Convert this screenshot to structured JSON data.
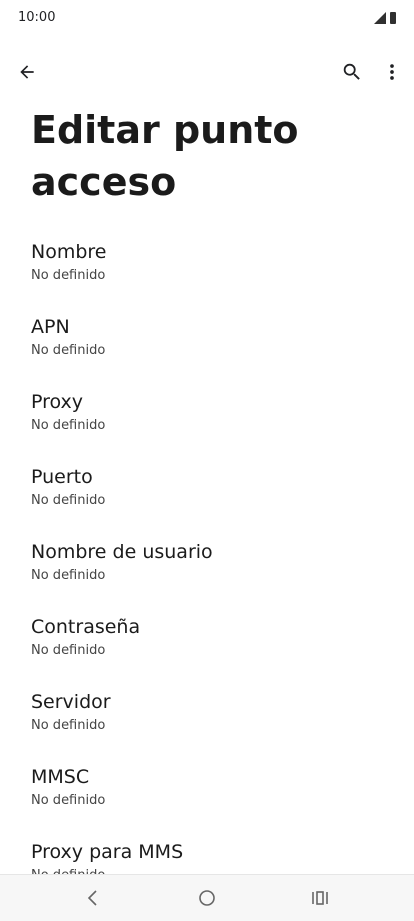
{
  "status": {
    "time": "10:00"
  },
  "toolbar": {
    "back_icon": "arrow-left-icon",
    "search_icon": "search-icon",
    "more_icon": "more-vertical-icon"
  },
  "page": {
    "title": "Editar punto acceso"
  },
  "items": [
    {
      "title": "Nombre",
      "value": "No definido"
    },
    {
      "title": "APN",
      "value": "No definido"
    },
    {
      "title": "Proxy",
      "value": "No definido"
    },
    {
      "title": "Puerto",
      "value": "No definido"
    },
    {
      "title": "Nombre de usuario",
      "value": "No definido"
    },
    {
      "title": "Contraseña",
      "value": "No definido"
    },
    {
      "title": "Servidor",
      "value": "No definido"
    },
    {
      "title": "MMSC",
      "value": "No definido"
    },
    {
      "title": "Proxy para MMS",
      "value": "No definido"
    }
  ],
  "navbar": {
    "back_icon": "nav-back-icon",
    "home_icon": "nav-home-icon",
    "recents_icon": "nav-recents-icon"
  }
}
